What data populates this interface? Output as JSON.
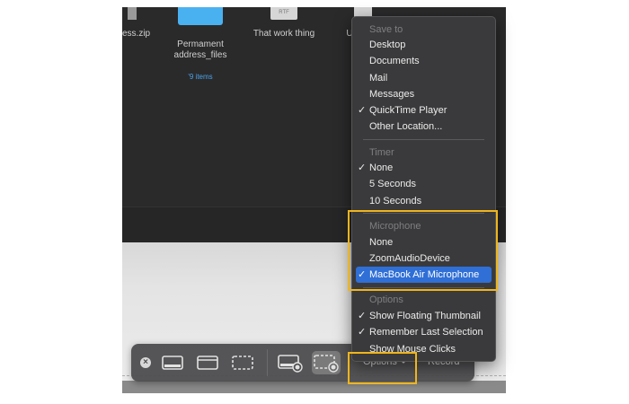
{
  "finder": {
    "files": [
      {
        "name": "ess.zip",
        "sub": ""
      },
      {
        "name": "Permament\naddress_files",
        "sub": "'9 items"
      },
      {
        "name": "That work thing",
        "sub": ""
      },
      {
        "name": "U",
        "sub": ""
      }
    ]
  },
  "menu": {
    "save_to": {
      "heading": "Save to",
      "items": [
        {
          "label": "Desktop",
          "checked": false
        },
        {
          "label": "Documents",
          "checked": false
        },
        {
          "label": "Mail",
          "checked": false
        },
        {
          "label": "Messages",
          "checked": false
        },
        {
          "label": "QuickTime Player",
          "checked": true
        },
        {
          "label": "Other Location...",
          "checked": false
        }
      ]
    },
    "timer": {
      "heading": "Timer",
      "items": [
        {
          "label": "None",
          "checked": true
        },
        {
          "label": "5 Seconds",
          "checked": false
        },
        {
          "label": "10 Seconds",
          "checked": false
        }
      ]
    },
    "microphone": {
      "heading": "Microphone",
      "items": [
        {
          "label": "None",
          "checked": false
        },
        {
          "label": "ZoomAudioDevice",
          "checked": false
        },
        {
          "label": "MacBook Air Microphone",
          "checked": true,
          "highlighted": true
        }
      ]
    },
    "options": {
      "heading": "Options",
      "items": [
        {
          "label": "Show Floating Thumbnail",
          "checked": true
        },
        {
          "label": "Remember Last Selection",
          "checked": true
        },
        {
          "label": "Show Mouse Clicks",
          "checked": false
        }
      ]
    },
    "check_glyph": "✓"
  },
  "toolbar": {
    "close_glyph": "×",
    "options_label": "Options",
    "record_label": "Record",
    "tools": [
      "capture-entire-screen-icon",
      "capture-window-icon",
      "capture-selection-icon",
      "record-entire-screen-icon",
      "record-selection-icon"
    ]
  },
  "colors": {
    "menu_bg": "#3a3a3c",
    "highlight": "#2f6fd6",
    "annotation": "#f0b51c",
    "folder": "#4ab1f0"
  }
}
